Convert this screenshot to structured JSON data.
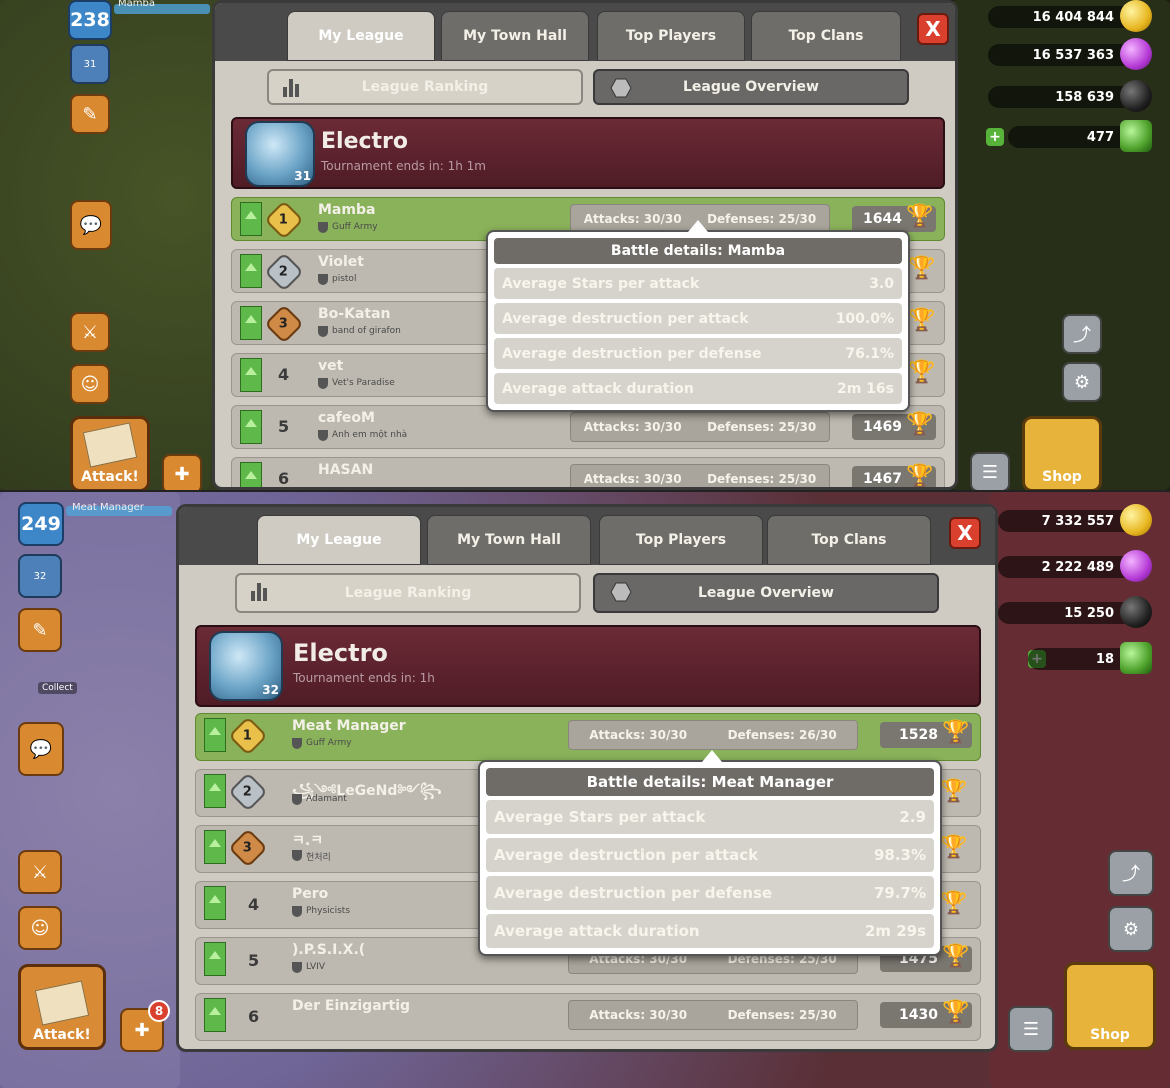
{
  "shot1": {
    "player": {
      "level": "238",
      "name": "Mamba",
      "league_badge_level": "31"
    },
    "resources": {
      "gold": "16 404 844",
      "elixir": "16 537 363",
      "dark_elixir": "158 639",
      "gems": "477"
    },
    "side_buttons": {
      "attack_label": "Attack!",
      "shop_label": "Shop"
    },
    "tabs": [
      "My League",
      "My Town Hall",
      "Top Players",
      "Top Clans"
    ],
    "close_label": "X",
    "sub_buttons": {
      "ranking": "League Ranking",
      "overview": "League Overview"
    },
    "league": {
      "name": "Electro",
      "subtitle": "Tournament ends in: 1h 1m",
      "badge_num": "31"
    },
    "rows": [
      {
        "rank": "1",
        "name": "Mamba",
        "clan": "Guff Army",
        "attacks": "Attacks: 30/30",
        "defenses": "Defenses: 25/30",
        "trophies": "1644"
      },
      {
        "rank": "2",
        "name": "Violet",
        "clan": "pistol",
        "attacks": "",
        "defenses": "",
        "trophies": ""
      },
      {
        "rank": "3",
        "name": "Bo-Katan",
        "clan": "band of girafon",
        "attacks": "",
        "defenses": "",
        "trophies": ""
      },
      {
        "rank": "4",
        "name": "vet",
        "clan": "Vet's Paradise",
        "attacks": "",
        "defenses": "",
        "trophies": ""
      },
      {
        "rank": "5",
        "name": "cafeoM",
        "clan": "Anh em một nhà",
        "attacks": "Attacks: 30/30",
        "defenses": "Defenses: 25/30",
        "trophies": "1469"
      },
      {
        "rank": "6",
        "name": "HASAN",
        "clan": "",
        "attacks": "Attacks: 30/30",
        "defenses": "Defenses: 25/30",
        "trophies": "1467"
      }
    ],
    "battle_details": {
      "title": "Battle details: Mamba",
      "rows": [
        {
          "label": "Average Stars per attack",
          "value": "3.0"
        },
        {
          "label": "Average destruction per attack",
          "value": "100.0%"
        },
        {
          "label": "Average destruction per defense",
          "value": "76.1%"
        },
        {
          "label": "Average attack duration",
          "value": "2m 16s"
        }
      ]
    }
  },
  "shot2": {
    "player": {
      "level": "249",
      "name": "Meat Manager",
      "league_badge_level": "32"
    },
    "resources": {
      "gold": "7 332 557",
      "elixir": "2 222 489",
      "dark_elixir": "15 250",
      "gems": "18"
    },
    "side_buttons": {
      "attack_label": "Attack!",
      "shop_label": "Shop",
      "notif_count": "8",
      "collect_label": "Collect"
    },
    "tabs": [
      "My League",
      "My Town Hall",
      "Top Players",
      "Top Clans"
    ],
    "close_label": "X",
    "sub_buttons": {
      "ranking": "League Ranking",
      "overview": "League Overview"
    },
    "league": {
      "name": "Electro",
      "subtitle": "Tournament ends in: 1h",
      "badge_num": "32"
    },
    "rows": [
      {
        "rank": "1",
        "name": "Meat Manager",
        "clan": "Guff Army",
        "attacks": "Attacks: 30/30",
        "defenses": "Defenses: 26/30",
        "trophies": "1528"
      },
      {
        "rank": "2",
        "name": "꧁༺LeGeNd༻꧂",
        "clan": "Adamant",
        "attacks": "",
        "defenses": "",
        "trophies": ""
      },
      {
        "rank": "3",
        "name": "ㅋ.ㅋ",
        "clan": "헌처리",
        "attacks": "",
        "defenses": "",
        "trophies": ""
      },
      {
        "rank": "4",
        "name": "Pero",
        "clan": "Physicists",
        "attacks": "",
        "defenses": "",
        "trophies": ""
      },
      {
        "rank": "5",
        "name": ").P.S.I.X.(",
        "clan": "LVIV",
        "attacks": "Attacks: 30/30",
        "defenses": "Defenses: 25/30",
        "trophies": "1475"
      },
      {
        "rank": "6",
        "name": "Der Einzigartig",
        "clan": "",
        "attacks": "Attacks: 30/30",
        "defenses": "Defenses: 25/30",
        "trophies": "1430"
      }
    ],
    "battle_details": {
      "title": "Battle details: Meat Manager",
      "rows": [
        {
          "label": "Average Stars per attack",
          "value": "2.9"
        },
        {
          "label": "Average destruction per attack",
          "value": "98.3%"
        },
        {
          "label": "Average destruction per defense",
          "value": "79.7%"
        },
        {
          "label": "Average attack duration",
          "value": "2m 29s"
        }
      ]
    }
  }
}
